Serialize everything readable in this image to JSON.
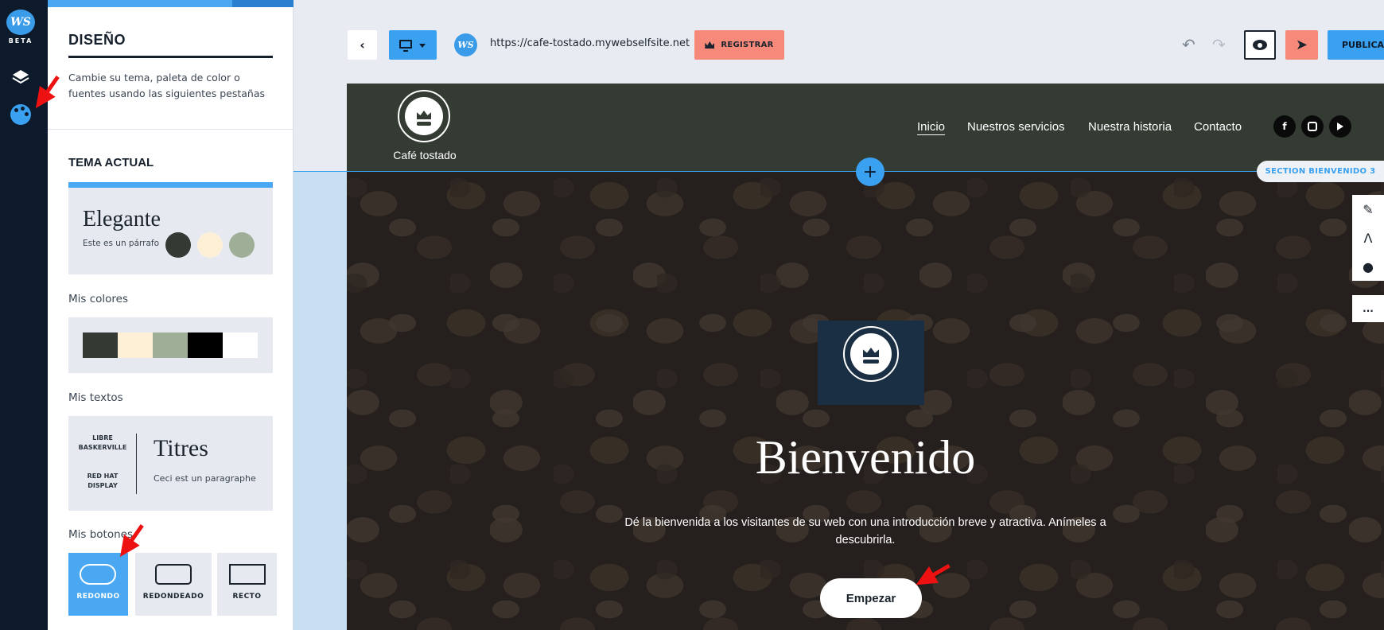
{
  "rail": {
    "logo_text": "WS",
    "beta_label": "BETA"
  },
  "panel": {
    "title": "DISEÑO",
    "description": "Cambie su tema, paleta de color o fuentes usando las siguientes pestañas",
    "current_theme_heading": "TEMA ACTUAL",
    "theme": {
      "name": "Elegante",
      "sample_text": "Este es un párrafo",
      "dots": [
        "#343a33",
        "#fdf0d6",
        "#9fae97"
      ]
    },
    "colors_label": "Mis colores",
    "colors": [
      "#343a33",
      "#fdf0d6",
      "#9fae97",
      "#000000",
      "#ffffff"
    ],
    "texts_label": "Mis textos",
    "texts": {
      "heading_font": "LIBRE BASKERVILLE",
      "body_font": "RED HAT DISPLAY",
      "title_sample": "Titres",
      "body_sample": "Ceci est un paragraphe"
    },
    "buttons_label": "Mis botones",
    "buttons": [
      {
        "label": "REDONDO",
        "selected": true
      },
      {
        "label": "REDONDEADO",
        "selected": false
      },
      {
        "label": "RECTO",
        "selected": false
      }
    ]
  },
  "toolbar": {
    "back_icon": "chevron-left-icon",
    "device_icon": "desktop-monitor-icon",
    "url": "https://cafe-tostado.mywebselfsite.net",
    "register_label": "REGISTRAR",
    "publish_label": "PUBLICAR",
    "accent_color": "#3aa0f0",
    "register_color": "#f7897a"
  },
  "site": {
    "brand_name": "Café tostado",
    "nav": [
      "Inicio",
      "Nuestros servicios",
      "Nuestra historia",
      "Contacto"
    ],
    "active_nav": "Inicio",
    "social": [
      "f",
      "ig",
      "yt"
    ],
    "header_color": "#333b33"
  },
  "hero": {
    "title": "Bienvenido",
    "text": "Dé la bienvenida a los visitantes de su web con una introducción breve y atractiva. Anímeles a descubrirla.",
    "button_label": "Empezar"
  },
  "editor": {
    "section_tag": "SECTION BIENVENIDO 3",
    "add_symbol": "+",
    "tools": [
      "pencil-icon",
      "compass-icon",
      "palette-icon"
    ],
    "more_label": "..."
  }
}
